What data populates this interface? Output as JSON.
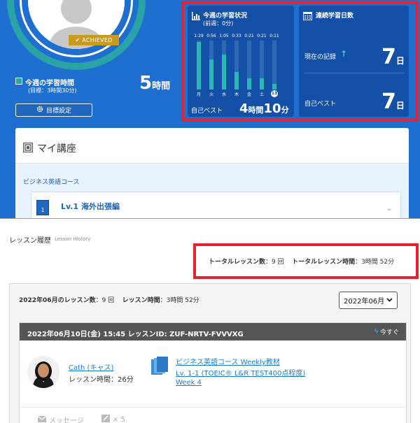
{
  "profile": {
    "badge": "ACHIEVED"
  },
  "weekly_study": {
    "label": "今週の学習時間",
    "target": "(目標：3時間30分)",
    "hours_value": "5",
    "hours_unit": "時間",
    "goal_button": "目標設定"
  },
  "week_status": {
    "title": "今週の学習状況",
    "subtitle": "(前週：0分)",
    "days": [
      {
        "day": "月",
        "time": "1:29",
        "fraction": 1.0
      },
      {
        "day": "火",
        "time": "0:56",
        "fraction": 0.63
      },
      {
        "day": "水",
        "time": "1:05",
        "fraction": 0.73
      },
      {
        "day": "木",
        "time": "0:33",
        "fraction": 0.37
      },
      {
        "day": "金",
        "time": "0:21",
        "fraction": 0.24
      },
      {
        "day": "土",
        "time": "0:21",
        "fraction": 0.24
      },
      {
        "day": "13",
        "time": "0:11",
        "fraction": 0.12,
        "today": true
      }
    ],
    "best_label": "自己ベスト",
    "best_hours": "4",
    "best_hours_unit": "時間",
    "best_minutes": "10",
    "best_minutes_unit": "分"
  },
  "streak": {
    "title": "連続学習日数",
    "current_label": "現在の記録",
    "current_value": "7",
    "unit": "日",
    "best_label": "自己ベスト",
    "best_value": "7"
  },
  "my_course": {
    "title": "マイ講座",
    "category": "ビジネス英語コース",
    "item_name": "Lv.1 海外出張編",
    "book_number": "1"
  },
  "history": {
    "title": "レッスン履歴",
    "subtitle": "Lesson History",
    "total_count_label": "トータルレッスン数",
    "total_count_value": "：9 回",
    "total_time_label": "トータルレッスン時間",
    "total_time_value": "：3時間 52分"
  },
  "month": {
    "count_label": "2022年06月のレッスン数",
    "count_value": "：9 回",
    "time_label": "レッスン時間",
    "time_value": "：3時間 52分",
    "select_value": "2022年06月"
  },
  "lesson": {
    "header": "2022年06月10日(金) 15:45 レッスンID: ZUF-NRTV-FVVVXG",
    "now_label": "今すぐ",
    "tutor_name": "Cath (キャス)",
    "lesson_time": "レッスン時間：26分",
    "material_course": "ビジネス英語コース Weekly教材",
    "material_level": "Lv. 1-1 (TOEIC® L&R TEST400点程度)",
    "material_week": "Week 4",
    "message_label": "メッセージ",
    "favorite_count": "× 5"
  },
  "colors": {
    "dashboard_bg": "#1e6fcf",
    "panel_bg": "#1550a8",
    "accent_teal": "#2ab9b2",
    "highlight_red": "#e52230",
    "badge_gold": "#c79b1e",
    "link_blue": "#1a7bd6"
  },
  "icons": [
    "user-avatar-icon",
    "check-icon",
    "gear-icon",
    "bar-chart-icon",
    "calendar-icon",
    "arrow-up-icon",
    "course-book-icon",
    "chevron-down-icon",
    "bolt-icon",
    "materials-icon",
    "mail-icon",
    "pencil-icon"
  ]
}
